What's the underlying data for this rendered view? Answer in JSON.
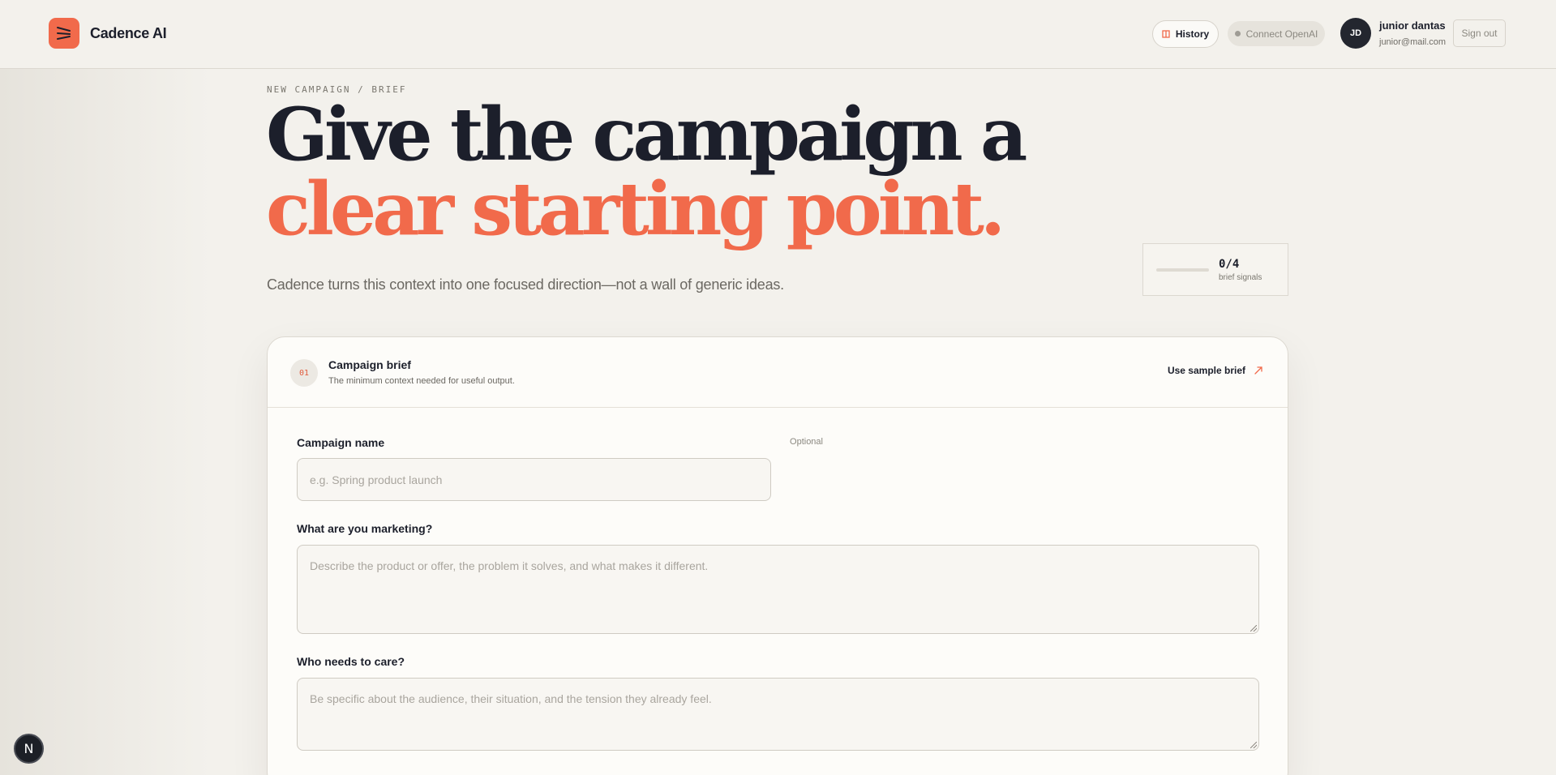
{
  "app": {
    "name": "Cadence AI"
  },
  "header": {
    "history_label": "History",
    "connect_label": "Connect OpenAI",
    "user": {
      "initials": "JD",
      "name": "junior dantas",
      "email": "junior@mail.com"
    },
    "signout_label": "Sign out"
  },
  "hero": {
    "breadcrumb": "NEW CAMPAIGN / BRIEF",
    "title_line1": "Give the campaign a",
    "title_line2": "clear starting point.",
    "subtitle": "Cadence turns this context into one focused direction—not a wall of generic ideas."
  },
  "signals": {
    "count": "0/4",
    "label": "brief signals",
    "progress": 0
  },
  "card": {
    "step": "01",
    "title": "Campaign brief",
    "description": "The minimum context needed for useful output.",
    "sample_label": "Use sample brief",
    "fields": [
      {
        "label": "Campaign name",
        "hint": "Optional",
        "placeholder": "e.g. Spring product launch"
      },
      {
        "label": "What are you marketing?",
        "placeholder": "Describe the product or offer, the problem it solves, and what makes it different."
      },
      {
        "label": "Who needs to care?",
        "placeholder": "Be specific about the audience, their situation, and the tension they already feel."
      }
    ]
  },
  "dev_badge": {
    "letter": "N"
  },
  "colors": {
    "accent": "#f16a4b",
    "ink": "#1c1f2b",
    "background": "#f3f1ec"
  }
}
